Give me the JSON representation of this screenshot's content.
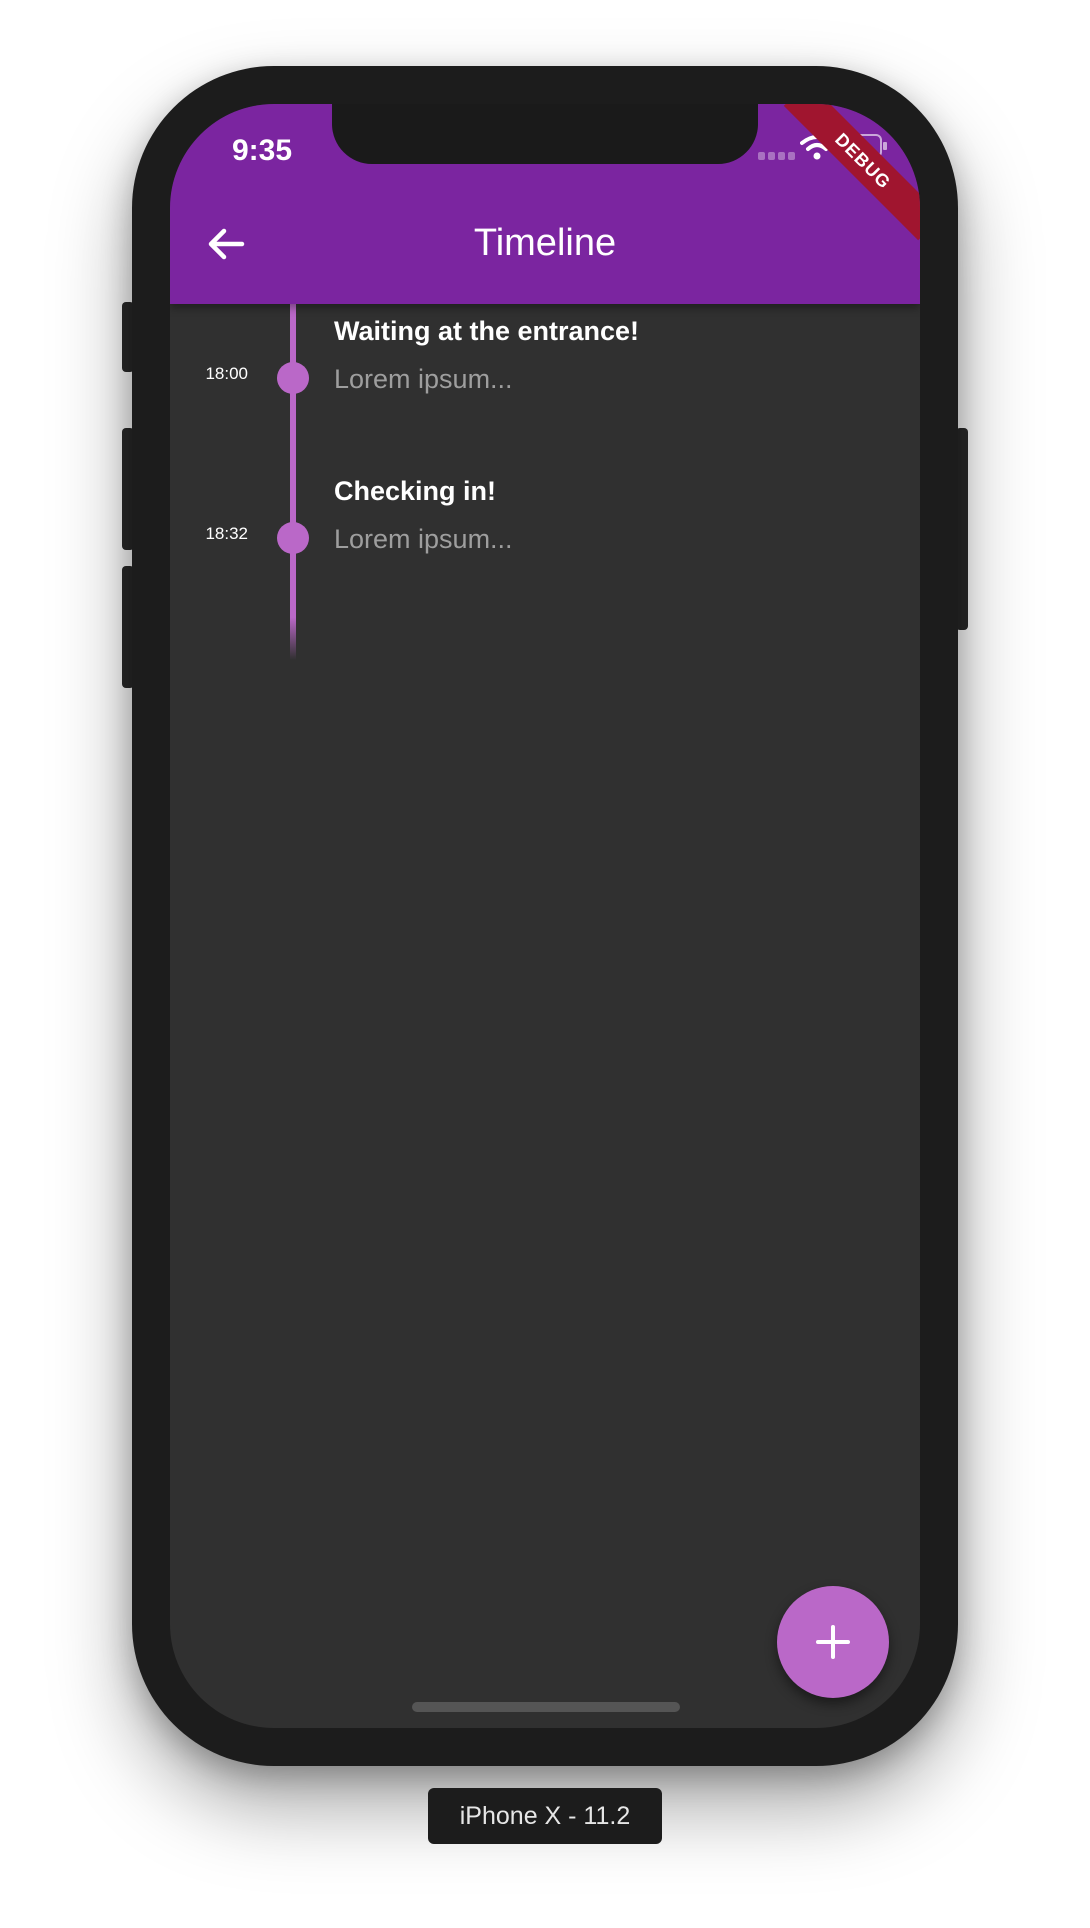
{
  "status_bar": {
    "time": "9:35",
    "icons": [
      "signal-icon",
      "wifi-icon",
      "battery-icon"
    ]
  },
  "debug_banner": "DEBUG",
  "app_bar": {
    "title": "Timeline",
    "back_icon": "arrow-back-icon",
    "color": "#7b25a0"
  },
  "timeline": {
    "accent_color": "#ba68c8",
    "events": [
      {
        "time": "18:00",
        "title": "Waiting at the entrance!",
        "description": "Lorem ipsum..."
      },
      {
        "time": "18:32",
        "title": "Checking in!",
        "description": "Lorem ipsum..."
      }
    ]
  },
  "fab": {
    "icon": "plus-icon"
  },
  "device_label": "iPhone X - 11.2",
  "colors": {
    "background": "#303030",
    "accent": "#ba68c8",
    "primary": "#7b25a0"
  }
}
